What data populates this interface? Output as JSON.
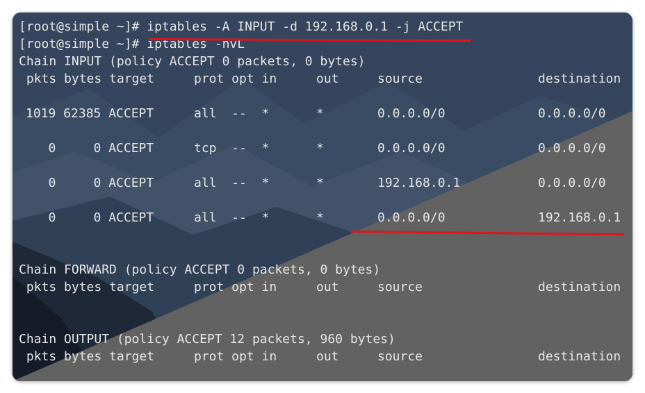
{
  "terminal": {
    "lines": [
      "[root@simple ~]# iptables -A INPUT -d 192.168.0.1 -j ACCEPT",
      "[root@simple ~]# iptables -nvL",
      "Chain INPUT (policy ACCEPT 0 packets, 0 bytes)"
    ],
    "input_chain": {
      "header": {
        "pkts_bytes_target": " pkts bytes target",
        "prot_opt_in": "prot opt in",
        "out": "out",
        "source": "source",
        "destination": "destination"
      },
      "rows": [
        {
          "counts_target": "1019 62385 ACCEPT",
          "prot_opt_in": "all  --  *",
          "out": "*",
          "source": "0.0.0.0/0",
          "destination": "0.0.0.0/0"
        },
        {
          "counts_target": "   0     0 ACCEPT",
          "prot_opt_in": "tcp  --  *",
          "out": "*",
          "source": "0.0.0.0/0",
          "destination": "0.0.0.0/0"
        },
        {
          "counts_target": "   0     0 ACCEPT",
          "prot_opt_in": "all  --  *",
          "out": "*",
          "source": "192.168.0.1",
          "destination": "0.0.0.0/0"
        },
        {
          "counts_target": "   0     0 ACCEPT",
          "prot_opt_in": "all  --  *",
          "out": "*",
          "source": "0.0.0.0/0",
          "destination": "192.168.0.1"
        }
      ]
    },
    "forward_chain": {
      "title": "Chain FORWARD (policy ACCEPT 0 packets, 0 bytes)",
      "header": {
        "pkts_bytes_target": " pkts bytes target",
        "prot_opt_in": "prot opt in",
        "out": "out",
        "source": "source",
        "destination": "destination"
      }
    },
    "output_chain": {
      "title": "Chain OUTPUT (policy ACCEPT 12 packets, 960 bytes)",
      "header": {
        "pkts_bytes_target": " pkts bytes target",
        "prot_opt_in": "prot opt in",
        "out": "out",
        "source": "source",
        "destination": "destination"
      }
    }
  },
  "colors": {
    "text": "#e6e6e6",
    "annotation_underline": "#e0141b",
    "sky": "#34455d",
    "slope": "#626262"
  }
}
